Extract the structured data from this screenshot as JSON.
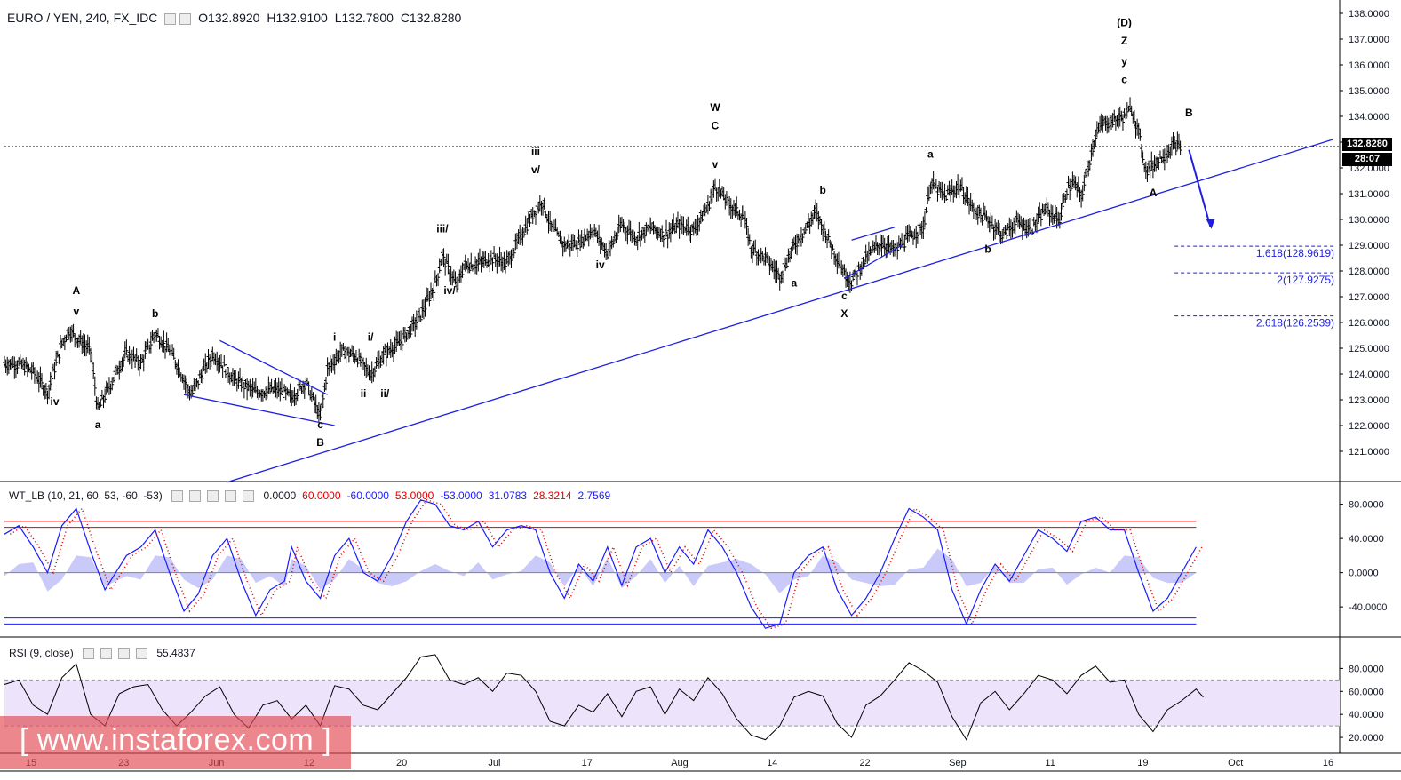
{
  "header": {
    "symbol": "EURO / YEN, 240, FX_IDC",
    "open": "O132.8920",
    "high": "H132.9100",
    "low": "L132.7800",
    "close": "C132.8280"
  },
  "wt_header": {
    "name": "WT_LB (10, 21, 60, 53, -60, -53)",
    "values": [
      {
        "text": "0.0000",
        "color": "#131722"
      },
      {
        "text": "60.0000",
        "color": "#e00000"
      },
      {
        "text": "-60.0000",
        "color": "#1a1aff"
      },
      {
        "text": "53.0000",
        "color": "#e00000"
      },
      {
        "text": "-53.0000",
        "color": "#1a1aff"
      },
      {
        "text": "31.0783",
        "color": "#1a1aff"
      },
      {
        "text": "28.3214",
        "color": "#e00000"
      },
      {
        "text": "2.7569",
        "color": "#1a1aff"
      }
    ]
  },
  "rsi_header": {
    "name": "RSI (9, close)",
    "value": "55.4837"
  },
  "price_tag": "132.8280",
  "time_tag": "28:07",
  "watermark": "[ www.instaforex.com ]",
  "colors": {
    "trend": "#1f1fe0",
    "price": "#000000",
    "wt_red": "#e00000",
    "wt_blue": "#1a1aff",
    "rsi_band": "#ede4fb"
  },
  "chart_data": {
    "type": "ohlc",
    "main": {
      "ylim": [
        120,
        138
      ],
      "yticks": [
        "121.0000",
        "122.0000",
        "123.0000",
        "124.0000",
        "125.0000",
        "126.0000",
        "127.0000",
        "128.0000",
        "129.0000",
        "130.0000",
        "131.0000",
        "132.0000",
        "133.0000",
        "134.0000",
        "135.0000",
        "136.0000",
        "137.0000",
        "138.0000"
      ],
      "xticks": [
        "15",
        "23",
        "Jun",
        "12",
        "20",
        "Jul",
        "17",
        "Aug",
        "14",
        "22",
        "Sep",
        "11",
        "19",
        "Oct",
        "16"
      ],
      "path_points": [
        [
          0,
          124.4
        ],
        [
          2,
          124.4
        ],
        [
          4,
          124.1
        ],
        [
          6,
          123.3
        ],
        [
          8,
          125.2
        ],
        [
          9,
          125.7
        ],
        [
          12,
          124.9
        ],
        [
          13,
          122.6
        ],
        [
          16,
          124.3
        ],
        [
          17,
          124.8
        ],
        [
          19,
          124.4
        ],
        [
          21,
          125.6
        ],
        [
          23,
          124.9
        ],
        [
          24,
          124.4
        ],
        [
          26,
          123.2
        ],
        [
          29,
          124.8
        ],
        [
          32,
          123.8
        ],
        [
          35,
          123.3
        ],
        [
          38,
          123.4
        ],
        [
          40,
          123.1
        ],
        [
          42,
          123.7
        ],
        [
          44,
          122.3
        ],
        [
          45,
          124.2
        ],
        [
          47,
          124.9
        ],
        [
          49,
          124.7
        ],
        [
          51,
          124.0
        ],
        [
          53,
          124.8
        ],
        [
          55,
          125.2
        ],
        [
          57,
          125.9
        ],
        [
          58,
          126.3
        ],
        [
          60,
          127.5
        ],
        [
          61,
          128.6
        ],
        [
          63,
          127.4
        ],
        [
          64,
          128.2
        ],
        [
          66,
          128.3
        ],
        [
          68,
          128.5
        ],
        [
          70,
          128.3
        ],
        [
          72,
          129.4
        ],
        [
          74,
          130.4
        ],
        [
          75,
          130.7
        ],
        [
          76,
          129.8
        ],
        [
          78,
          129.0
        ],
        [
          80,
          129.1
        ],
        [
          82,
          129.6
        ],
        [
          84,
          128.7
        ],
        [
          86,
          129.8
        ],
        [
          88,
          129.3
        ],
        [
          90,
          129.7
        ],
        [
          92,
          129.4
        ],
        [
          94,
          129.8
        ],
        [
          96,
          129.6
        ],
        [
          98,
          130.5
        ],
        [
          99,
          131.3
        ],
        [
          101,
          130.6
        ],
        [
          103,
          130.1
        ],
        [
          104,
          128.9
        ],
        [
          106,
          128.5
        ],
        [
          108,
          127.8
        ],
        [
          110,
          129.0
        ],
        [
          112,
          129.8
        ],
        [
          113,
          130.3
        ],
        [
          115,
          129.1
        ],
        [
          117,
          127.9
        ],
        [
          118,
          127.6
        ],
        [
          120,
          128.5
        ],
        [
          122,
          129.1
        ],
        [
          124,
          128.8
        ],
        [
          126,
          129.3
        ],
        [
          128,
          129.7
        ],
        [
          129,
          131.4
        ],
        [
          131,
          130.9
        ],
        [
          133,
          131.3
        ],
        [
          135,
          130.4
        ],
        [
          137,
          130.0
        ],
        [
          139,
          129.4
        ],
        [
          141,
          129.9
        ],
        [
          143,
          129.6
        ],
        [
          145,
          130.4
        ],
        [
          147,
          130.0
        ],
        [
          148,
          131.2
        ],
        [
          149,
          131.4
        ],
        [
          150,
          130.9
        ],
        [
          151,
          132.1
        ],
        [
          152,
          133.3
        ],
        [
          153,
          133.7
        ],
        [
          155,
          133.9
        ],
        [
          156,
          134.0
        ],
        [
          157,
          134.3
        ],
        [
          158,
          133.4
        ],
        [
          159,
          131.9
        ],
        [
          160,
          132.1
        ],
        [
          161,
          132.4
        ],
        [
          162,
          132.6
        ],
        [
          163,
          132.9
        ],
        [
          164,
          132.8
        ]
      ],
      "trendline": [
        [
          31,
          119.8
        ],
        [
          185,
          133.1
        ]
      ],
      "upper_channel": [
        [
          30,
          125.3
        ],
        [
          45,
          123.2
        ]
      ],
      "lower_channel": [
        [
          25,
          123.2
        ],
        [
          46,
          122.0
        ]
      ],
      "wedge_upper": [
        [
          118,
          129.2
        ],
        [
          124,
          129.7
        ]
      ],
      "wedge_lower": [
        [
          117,
          127.7
        ],
        [
          125,
          129.0
        ]
      ],
      "horizontal_price": 132.828,
      "fib_levels": [
        {
          "label": "1.618(128.9619)",
          "value": 128.9619
        },
        {
          "label": "2(127.9275)",
          "value": 127.9275
        },
        {
          "label": "2.618(126.2539)",
          "value": 126.2539
        }
      ],
      "projection_arrow": [
        [
          165,
          132.7
        ],
        [
          168,
          129.7
        ]
      ],
      "wave_labels": [
        {
          "text": "A",
          "x": 10,
          "y": 127.1
        },
        {
          "text": "v",
          "x": 10,
          "y": 126.3
        },
        {
          "text": "iv",
          "x": 7,
          "y": 122.8
        },
        {
          "text": "a",
          "x": 13,
          "y": 121.9
        },
        {
          "text": "b",
          "x": 21,
          "y": 126.2
        },
        {
          "text": "c",
          "x": 44,
          "y": 121.9
        },
        {
          "text": "B",
          "x": 44,
          "y": 121.2
        },
        {
          "text": "i",
          "x": 46,
          "y": 125.3
        },
        {
          "text": "i/",
          "x": 51,
          "y": 125.3
        },
        {
          "text": "ii",
          "x": 50,
          "y": 123.1
        },
        {
          "text": "ii/",
          "x": 53,
          "y": 123.1
        },
        {
          "text": "iii/",
          "x": 61,
          "y": 129.5
        },
        {
          "text": "iv/",
          "x": 62,
          "y": 127.1
        },
        {
          "text": "iii",
          "x": 74,
          "y": 132.5
        },
        {
          "text": "v/",
          "x": 74,
          "y": 131.8
        },
        {
          "text": "iv",
          "x": 83,
          "y": 128.1
        },
        {
          "text": "W",
          "x": 99,
          "y": 134.2
        },
        {
          "text": "C",
          "x": 99,
          "y": 133.5
        },
        {
          "text": "v",
          "x": 99,
          "y": 132.0
        },
        {
          "text": "a",
          "x": 110,
          "y": 127.4
        },
        {
          "text": "b",
          "x": 114,
          "y": 131.0
        },
        {
          "text": "c",
          "x": 117,
          "y": 126.9
        },
        {
          "text": "X",
          "x": 117,
          "y": 126.2
        },
        {
          "text": "a",
          "x": 129,
          "y": 132.4
        },
        {
          "text": "b",
          "x": 137,
          "y": 128.7
        },
        {
          "text": "(D)",
          "x": 156,
          "y": 137.5
        },
        {
          "text": "Z",
          "x": 156,
          "y": 136.8
        },
        {
          "text": "y",
          "x": 156,
          "y": 136.0
        },
        {
          "text": "c",
          "x": 156,
          "y": 135.3
        },
        {
          "text": "B",
          "x": 165,
          "y": 134.0
        },
        {
          "text": "A",
          "x": 160,
          "y": 130.9
        }
      ]
    },
    "wt": {
      "ylim": [
        -70,
        90
      ],
      "yticks": [
        "-40.0000",
        "0.0000",
        "40.0000",
        "80.0000"
      ],
      "levels": [
        60,
        53,
        -53,
        -60
      ],
      "wt1": [
        [
          0,
          45
        ],
        [
          2,
          55
        ],
        [
          4,
          30
        ],
        [
          6,
          0
        ],
        [
          8,
          55
        ],
        [
          10,
          75
        ],
        [
          12,
          25
        ],
        [
          14,
          -20
        ],
        [
          17,
          20
        ],
        [
          19,
          30
        ],
        [
          21,
          50
        ],
        [
          23,
          0
        ],
        [
          25,
          -45
        ],
        [
          27,
          -25
        ],
        [
          29,
          20
        ],
        [
          31,
          40
        ],
        [
          33,
          -10
        ],
        [
          35,
          -50
        ],
        [
          37,
          -20
        ],
        [
          39,
          -10
        ],
        [
          40,
          30
        ],
        [
          42,
          -10
        ],
        [
          44,
          -30
        ],
        [
          46,
          20
        ],
        [
          48,
          40
        ],
        [
          50,
          0
        ],
        [
          52,
          -10
        ],
        [
          54,
          20
        ],
        [
          56,
          60
        ],
        [
          58,
          85
        ],
        [
          60,
          80
        ],
        [
          62,
          55
        ],
        [
          64,
          50
        ],
        [
          66,
          60
        ],
        [
          68,
          30
        ],
        [
          70,
          50
        ],
        [
          72,
          55
        ],
        [
          74,
          50
        ],
        [
          76,
          0
        ],
        [
          78,
          -30
        ],
        [
          80,
          10
        ],
        [
          82,
          -10
        ],
        [
          84,
          30
        ],
        [
          86,
          -15
        ],
        [
          88,
          30
        ],
        [
          90,
          40
        ],
        [
          92,
          0
        ],
        [
          94,
          30
        ],
        [
          96,
          10
        ],
        [
          98,
          50
        ],
        [
          100,
          30
        ],
        [
          102,
          0
        ],
        [
          104,
          -40
        ],
        [
          106,
          -65
        ],
        [
          108,
          -60
        ],
        [
          110,
          0
        ],
        [
          112,
          20
        ],
        [
          114,
          30
        ],
        [
          116,
          -20
        ],
        [
          118,
          -50
        ],
        [
          120,
          -30
        ],
        [
          122,
          0
        ],
        [
          124,
          40
        ],
        [
          126,
          75
        ],
        [
          128,
          65
        ],
        [
          130,
          50
        ],
        [
          132,
          -20
        ],
        [
          134,
          -60
        ],
        [
          136,
          -20
        ],
        [
          138,
          10
        ],
        [
          140,
          -10
        ],
        [
          142,
          20
        ],
        [
          144,
          50
        ],
        [
          146,
          40
        ],
        [
          148,
          25
        ],
        [
          150,
          60
        ],
        [
          152,
          65
        ],
        [
          154,
          50
        ],
        [
          156,
          50
        ],
        [
          158,
          0
        ],
        [
          160,
          -45
        ],
        [
          162,
          -30
        ],
        [
          164,
          0
        ],
        [
          166,
          30
        ]
      ]
    },
    "rsi": {
      "ylim": [
        10,
        95
      ],
      "yticks": [
        "20.0000",
        "40.0000",
        "60.0000",
        "80.0000"
      ],
      "band": [
        30,
        70
      ],
      "values": [
        [
          0,
          66
        ],
        [
          2,
          70
        ],
        [
          4,
          48
        ],
        [
          6,
          40
        ],
        [
          8,
          72
        ],
        [
          10,
          84
        ],
        [
          12,
          40
        ],
        [
          14,
          30
        ],
        [
          16,
          58
        ],
        [
          18,
          64
        ],
        [
          20,
          66
        ],
        [
          22,
          44
        ],
        [
          24,
          30
        ],
        [
          26,
          42
        ],
        [
          28,
          56
        ],
        [
          30,
          64
        ],
        [
          32,
          40
        ],
        [
          34,
          28
        ],
        [
          36,
          48
        ],
        [
          38,
          52
        ],
        [
          40,
          36
        ],
        [
          42,
          48
        ],
        [
          44,
          30
        ],
        [
          46,
          65
        ],
        [
          48,
          62
        ],
        [
          50,
          48
        ],
        [
          52,
          44
        ],
        [
          54,
          58
        ],
        [
          56,
          72
        ],
        [
          58,
          90
        ],
        [
          60,
          92
        ],
        [
          62,
          70
        ],
        [
          64,
          66
        ],
        [
          66,
          72
        ],
        [
          68,
          60
        ],
        [
          70,
          76
        ],
        [
          72,
          74
        ],
        [
          74,
          60
        ],
        [
          76,
          34
        ],
        [
          78,
          30
        ],
        [
          80,
          48
        ],
        [
          82,
          42
        ],
        [
          84,
          58
        ],
        [
          86,
          38
        ],
        [
          88,
          60
        ],
        [
          90,
          64
        ],
        [
          92,
          40
        ],
        [
          94,
          62
        ],
        [
          96,
          52
        ],
        [
          98,
          72
        ],
        [
          100,
          58
        ],
        [
          102,
          36
        ],
        [
          104,
          22
        ],
        [
          106,
          18
        ],
        [
          108,
          30
        ],
        [
          110,
          55
        ],
        [
          112,
          60
        ],
        [
          114,
          56
        ],
        [
          116,
          32
        ],
        [
          118,
          20
        ],
        [
          120,
          48
        ],
        [
          122,
          56
        ],
        [
          124,
          70
        ],
        [
          126,
          85
        ],
        [
          128,
          78
        ],
        [
          130,
          68
        ],
        [
          132,
          38
        ],
        [
          134,
          18
        ],
        [
          136,
          50
        ],
        [
          138,
          60
        ],
        [
          140,
          44
        ],
        [
          142,
          58
        ],
        [
          144,
          74
        ],
        [
          146,
          70
        ],
        [
          148,
          58
        ],
        [
          150,
          74
        ],
        [
          152,
          82
        ],
        [
          154,
          68
        ],
        [
          156,
          70
        ],
        [
          158,
          40
        ],
        [
          160,
          25
        ],
        [
          162,
          44
        ],
        [
          164,
          52
        ],
        [
          166,
          62
        ],
        [
          167,
          55
        ]
      ]
    }
  }
}
